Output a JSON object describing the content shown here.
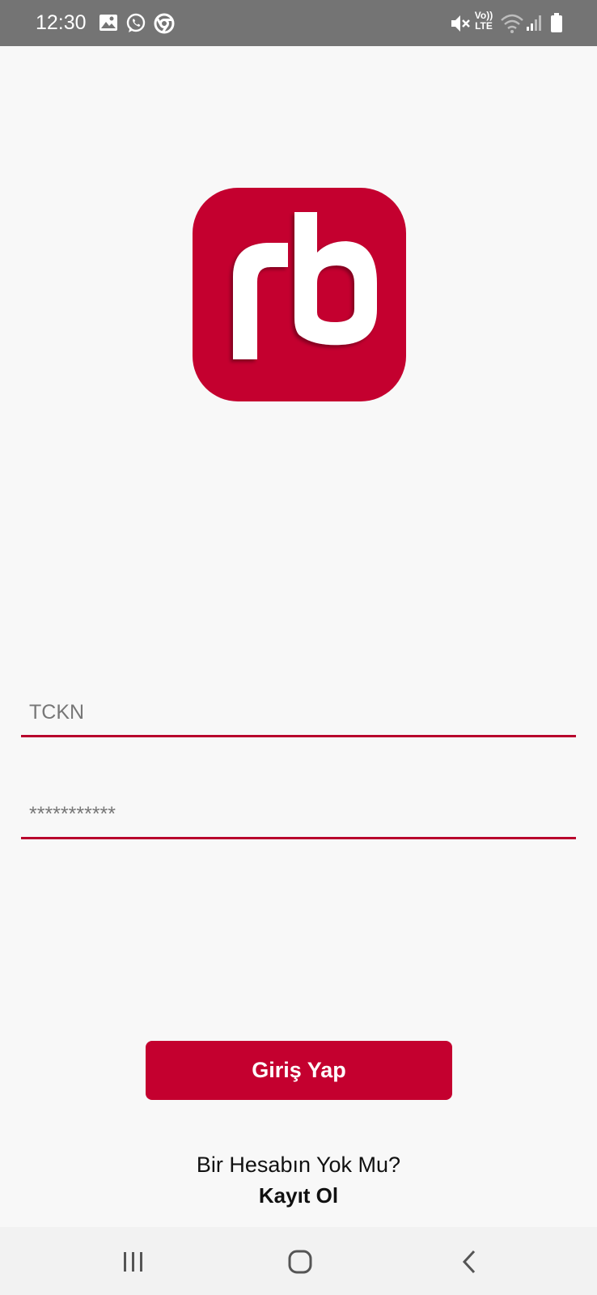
{
  "status_bar": {
    "time": "12:30",
    "left_icons": [
      "image-icon",
      "whatsapp-icon",
      "chrome-icon"
    ],
    "right_icons": [
      "mute-icon",
      "volte-icon",
      "wifi-icon",
      "signal-icon",
      "battery-icon"
    ],
    "volte_text_top": "Vo))",
    "volte_text_bottom": "LTE"
  },
  "logo": {
    "text": "rb",
    "background_color": "#c4002f"
  },
  "form": {
    "tckn_placeholder": "TCKN",
    "password_placeholder": "***********",
    "underline_color": "#b8002c"
  },
  "login_button": {
    "label": "Giriş Yap",
    "color": "#c4002f"
  },
  "register": {
    "prompt": "Bir Hesabın Yok Mu?",
    "link_label": "Kayıt Ol"
  },
  "nav_bar": {
    "buttons": [
      "recent-apps-icon",
      "home-icon",
      "back-icon"
    ]
  }
}
